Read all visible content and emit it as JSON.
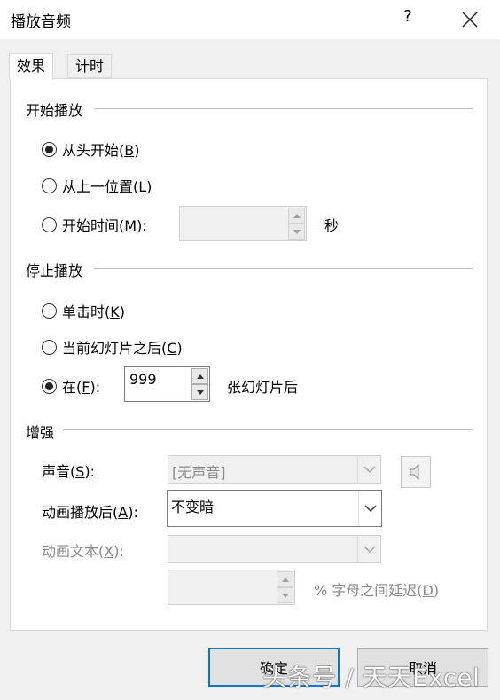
{
  "window": {
    "title": "播放音频",
    "help_label": "?"
  },
  "tabs": [
    {
      "label": "效果",
      "active": true
    },
    {
      "label": "计时",
      "active": false
    }
  ],
  "start_section": {
    "title": "开始播放",
    "options": [
      {
        "label": "从头开始(",
        "key": "B",
        "suffix": ")",
        "checked": true
      },
      {
        "label": "从上一位置(",
        "key": "L",
        "suffix": ")",
        "checked": false
      },
      {
        "label": "开始时间(",
        "key": "M",
        "suffix": "):",
        "checked": false
      }
    ],
    "time_value": "",
    "time_unit": "秒"
  },
  "stop_section": {
    "title": "停止播放",
    "options": [
      {
        "label": "单击时(",
        "key": "K",
        "suffix": ")",
        "checked": false
      },
      {
        "label": "当前幻灯片之后(",
        "key": "C",
        "suffix": ")",
        "checked": false
      },
      {
        "label": "在(",
        "key": "F",
        "suffix": "):",
        "checked": true
      }
    ],
    "slides_value": "999",
    "slides_suffix": "张幻灯片后"
  },
  "enhance_section": {
    "title": "增强",
    "sound": {
      "label": "声音(",
      "key": "S",
      "suffix": "):",
      "value": "[无声音]",
      "enabled": false
    },
    "after_anim": {
      "label": "动画播放后(",
      "key": "A",
      "suffix": "):",
      "value": "不变暗",
      "enabled": true
    },
    "anim_text": {
      "label": "动画文本(",
      "key": "X",
      "suffix": "):",
      "value": "",
      "enabled": false
    },
    "delay": {
      "value": "",
      "label": "% 字母之间延迟(",
      "key": "D",
      "suffix": ")",
      "enabled": false
    }
  },
  "buttons": {
    "ok": "确定",
    "cancel": "取消"
  },
  "watermark": "头条号 / 天天Excel"
}
